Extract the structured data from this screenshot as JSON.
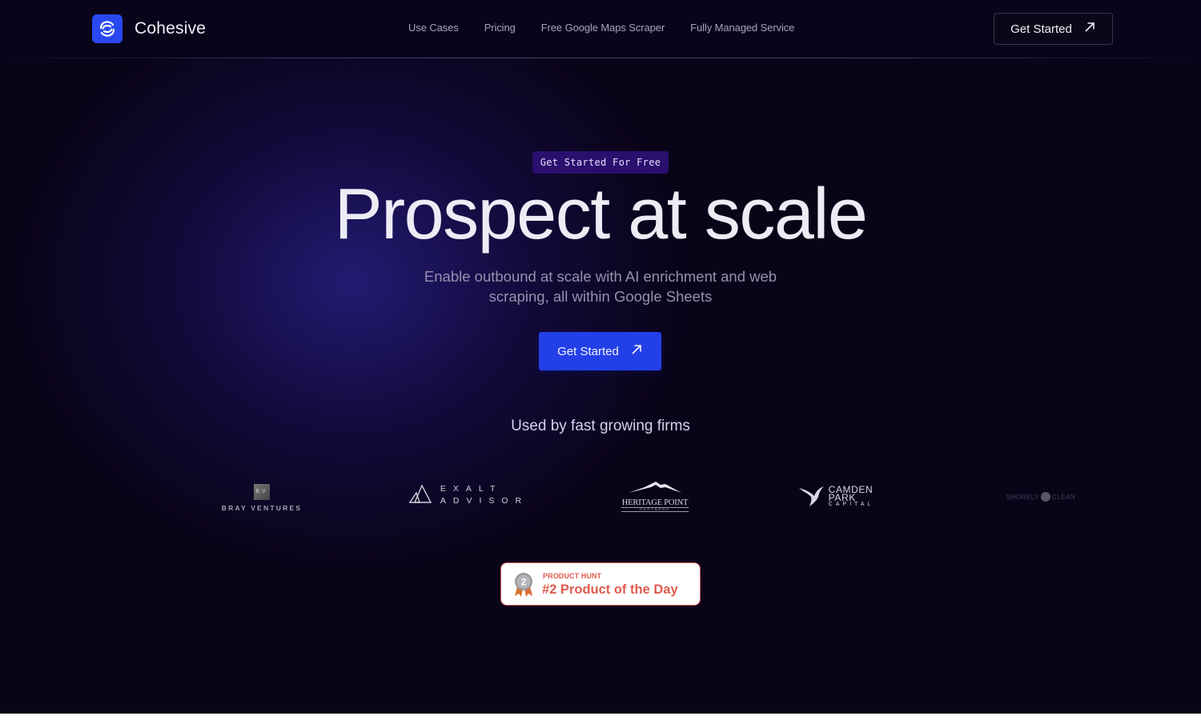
{
  "brand": {
    "name": "Cohesive",
    "accent_color": "#2a48f0"
  },
  "nav": {
    "items": [
      {
        "label": "Use Cases"
      },
      {
        "label": "Pricing"
      },
      {
        "label": "Free Google Maps Scraper"
      },
      {
        "label": "Fully Managed Service"
      }
    ],
    "cta_label": "Get Started",
    "cta_icon": "arrow-up-right-icon"
  },
  "hero": {
    "badge": "Get Started For Free",
    "title": "Prospect at scale",
    "subtitle": "Enable outbound at scale with AI enrichment and web scraping, all within Google Sheets",
    "cta_label": "Get Started",
    "cta_icon": "arrow-up-right-icon",
    "cta_color": "#2340e8"
  },
  "social_proof": {
    "heading": "Used by fast growing firms",
    "logos": [
      {
        "name": "Bray Ventures",
        "mark": "BV",
        "text": "BRAY VENTURES"
      },
      {
        "name": "Exalt Advisor",
        "line1": "EXALT",
        "line2": "ADVISOR"
      },
      {
        "name": "Heritage Point Partners",
        "line1": "HERITAGE POINT",
        "line2": "PARTNERS"
      },
      {
        "name": "Camden Park Capital",
        "line1": "CAMDEN",
        "line2": "PARK",
        "line3": "CAPITAL"
      },
      {
        "name": "Shorely Clean",
        "left": "SHORELY",
        "right": "CLEAN"
      }
    ]
  },
  "product_hunt": {
    "label": "PRODUCT HUNT",
    "title": "#2 Product of the Day",
    "rank": "2",
    "color": "#de5b4f"
  }
}
